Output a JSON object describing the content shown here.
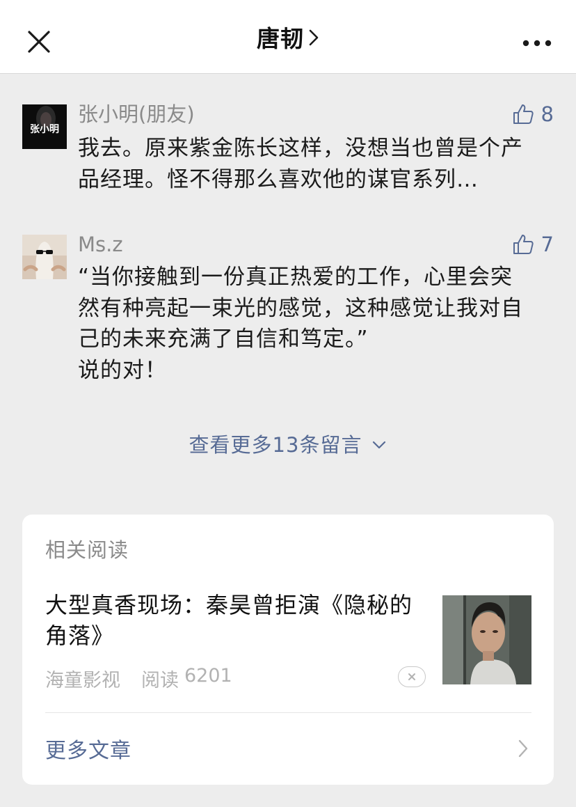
{
  "header": {
    "title": "唐韧",
    "close_icon": "close-icon",
    "more_icon": "more-dots-icon"
  },
  "comments": [
    {
      "name": "张小明(朋友)",
      "avatar_text": "张小明",
      "likes": "8",
      "text": "我去。原来紫金陈长这样，没想当也曾是个产\n品经理。怪不得那么喜欢他的谋官系列…"
    },
    {
      "name": "Ms.z",
      "likes": "7",
      "text": "“当你接触到一份真正热爱的工作，心里会突\n然有种亮起一束光的感觉，这种感觉让我对自\n己的未来充满了自信和笃定。”\n说的对！"
    }
  ],
  "view_more": {
    "label": "查看更多13条留言"
  },
  "related": {
    "title": "相关阅读",
    "article": {
      "headline": "大型真香现场：秦昊曾拒演《隐秘的角落》",
      "source": "海童影视",
      "views_label": "阅读",
      "views": "6201"
    },
    "more_label": "更多文章"
  },
  "colors": {
    "background": "#ededed",
    "link": "#576b95",
    "secondary_text": "#8a8a8a",
    "meta_text": "#b2b2b2"
  }
}
